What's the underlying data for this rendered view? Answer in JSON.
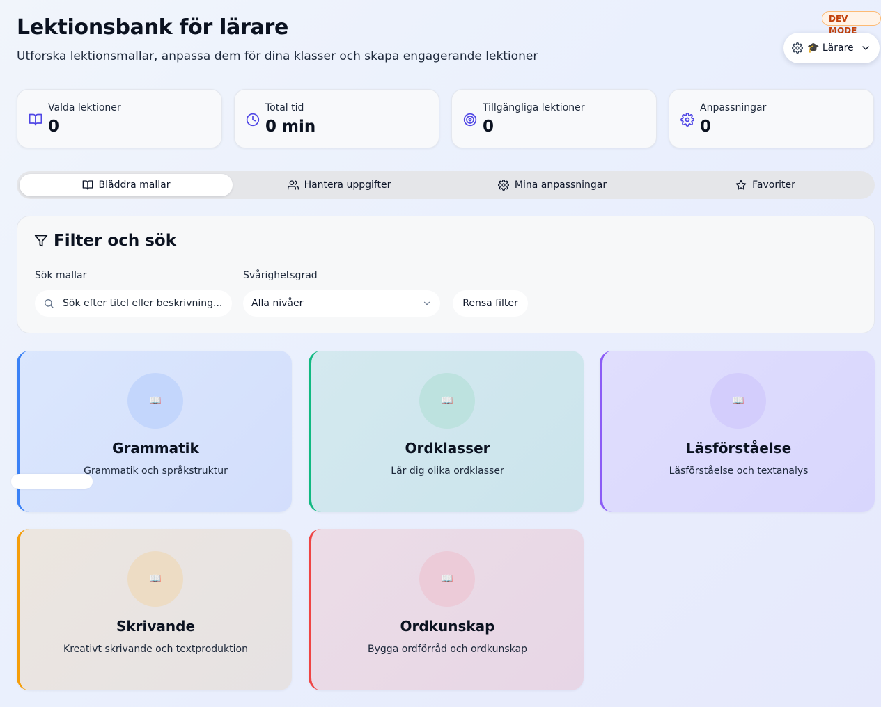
{
  "header": {
    "title": "Lektionsbank för lärare",
    "subtitle": "Utforska lektionsmallar, anpassa dem för dina klasser och skapa engagerande lektioner"
  },
  "dev_badge": "DEV MODE",
  "role_selector": {
    "label": "🎓 Lärare",
    "icons": [
      "gear-icon",
      "chevron-down-icon"
    ]
  },
  "stats": [
    {
      "label": "Valda lektioner",
      "value": "0",
      "icon": "book-open-icon"
    },
    {
      "label": "Total tid",
      "value": "0 min",
      "icon": "clock-icon"
    },
    {
      "label": "Tillgängliga lektioner",
      "value": "0",
      "icon": "target-icon"
    },
    {
      "label": "Anpassningar",
      "value": "0",
      "icon": "gear-icon"
    }
  ],
  "tabs": [
    {
      "label": "Bläddra mallar",
      "icon": "book-open-icon",
      "active": true
    },
    {
      "label": "Hantera uppgifter",
      "icon": "users-icon",
      "active": false
    },
    {
      "label": "Mina anpassningar",
      "icon": "gear-icon",
      "active": false
    },
    {
      "label": "Favoriter",
      "icon": "star-icon",
      "active": false
    }
  ],
  "filter": {
    "title": "Filter och sök",
    "search_label": "Sök mallar",
    "search_placeholder": "Sök efter titel eller beskrivning...",
    "search_value": "",
    "level_label": "Svårighetsgrad",
    "level_value": "Alla nivåer",
    "clear_label": "Rensa filter"
  },
  "categories": [
    {
      "name": "Grammatik",
      "description": "Grammatik och språkstruktur",
      "icon": "📖",
      "accent": "#3b82f6"
    },
    {
      "name": "Ordklasser",
      "description": "Lär dig olika ordklasser",
      "icon": "📖",
      "accent": "#10b981"
    },
    {
      "name": "Läsförståelse",
      "description": "Läsförståelse och textanalys",
      "icon": "📖",
      "accent": "#8b5cf6"
    },
    {
      "name": "Skrivande",
      "description": "Kreativt skrivande och textproduktion",
      "icon": "📖",
      "accent": "#f59e0b"
    },
    {
      "name": "Ordkunskap",
      "description": "Bygga ordförråd och ordkunskap",
      "icon": "📖",
      "accent": "#ef4444"
    }
  ],
  "colors": {
    "accent": "#4f46e5",
    "dev_badge": "#c2410c"
  }
}
